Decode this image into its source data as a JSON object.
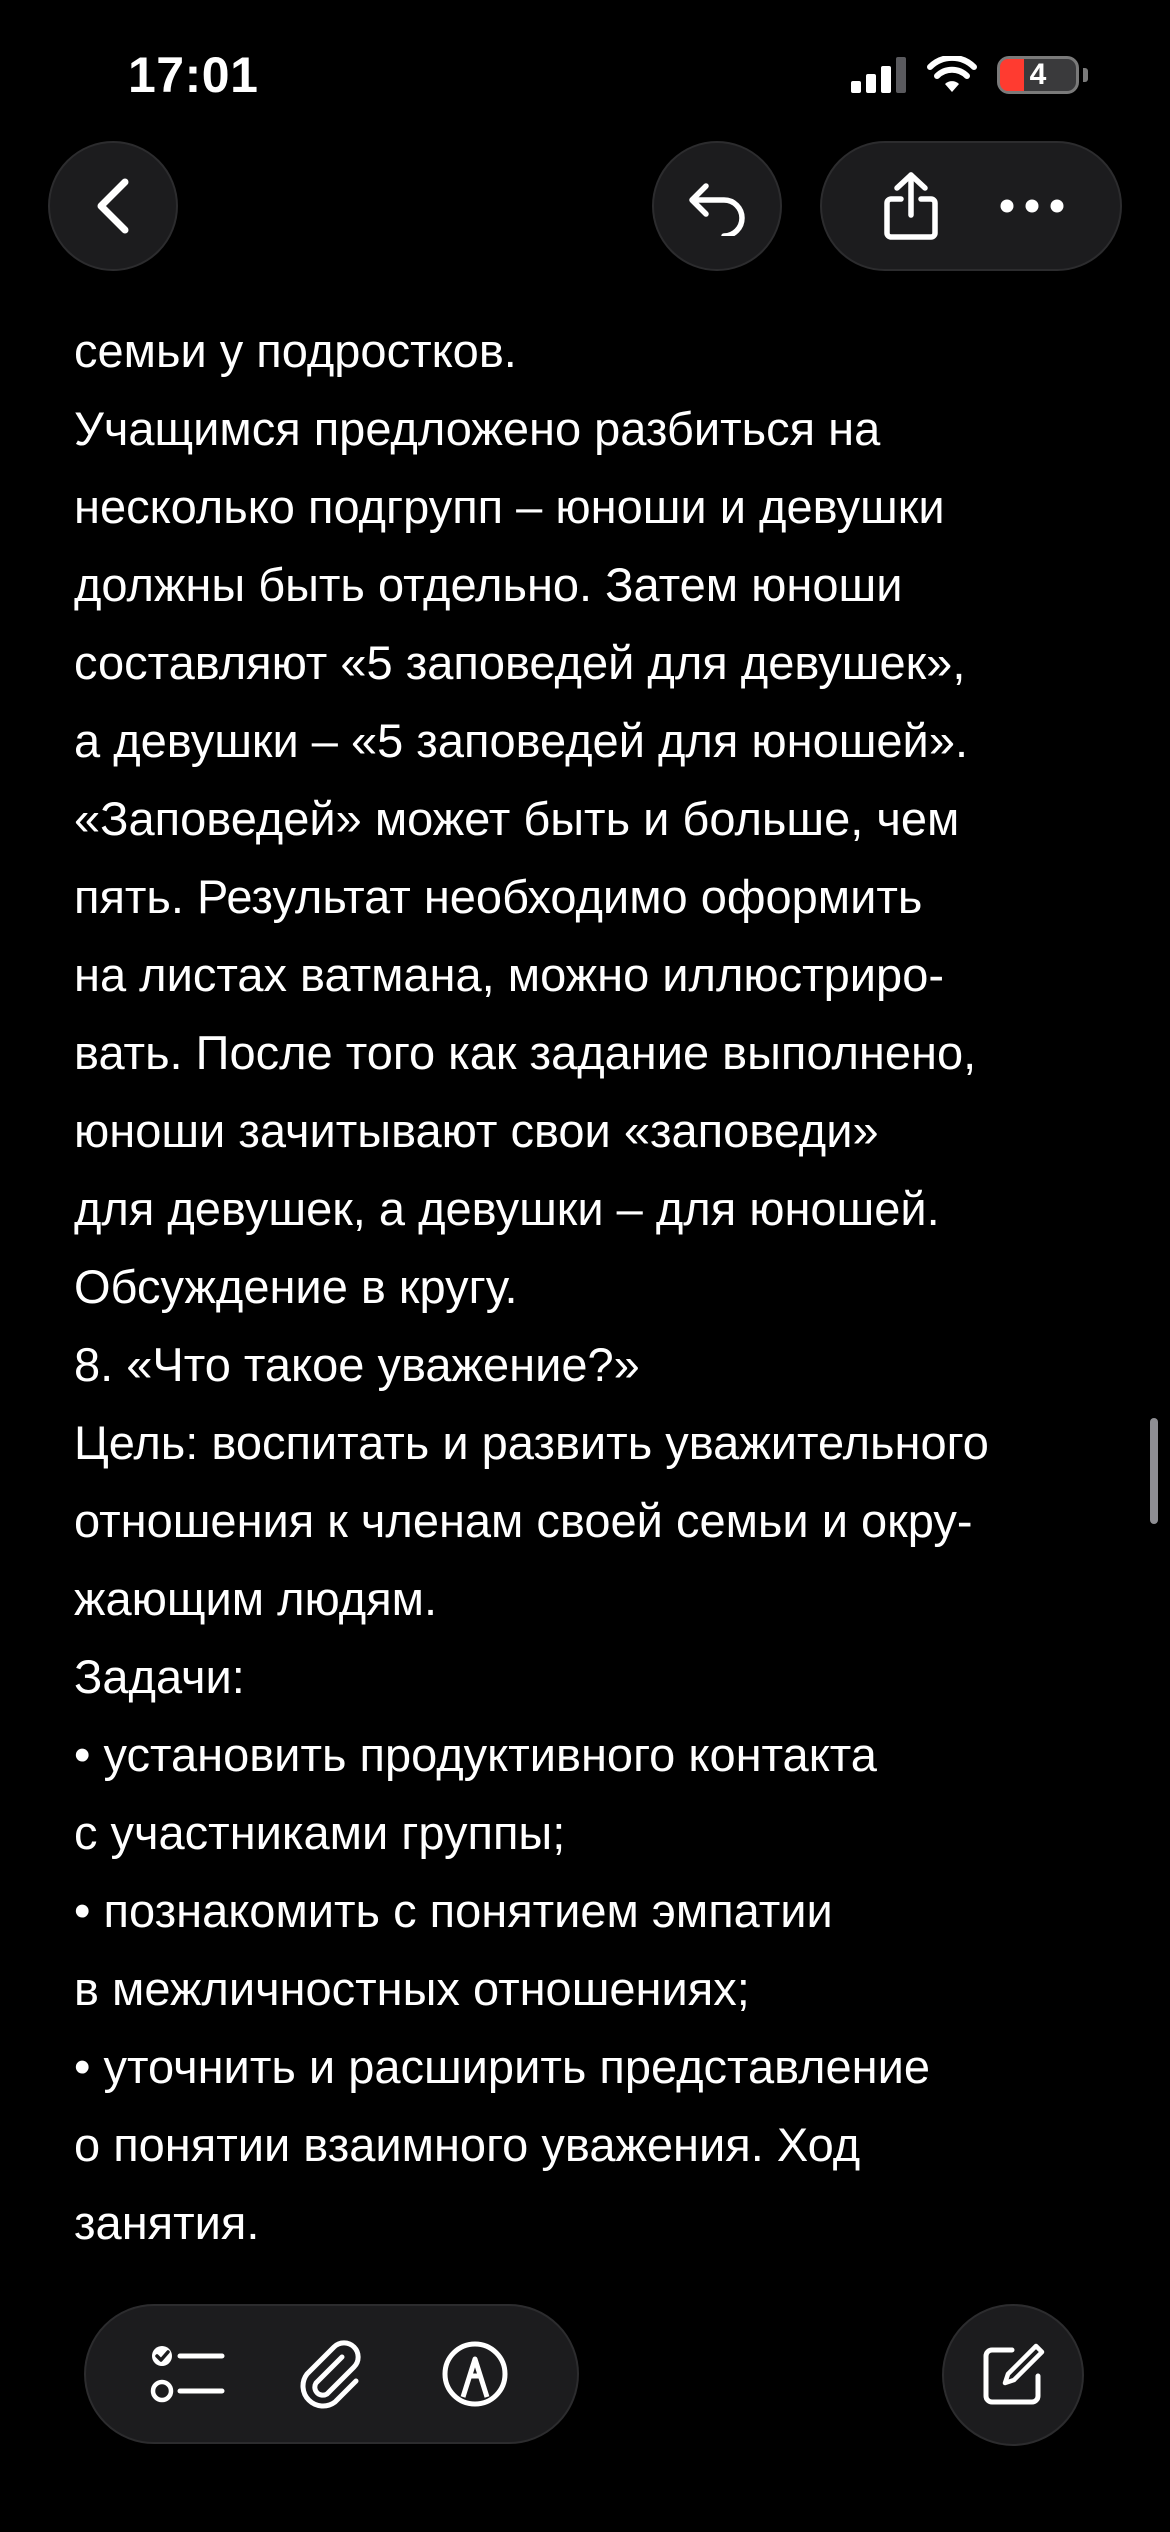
{
  "status_bar": {
    "time": "17:01",
    "battery_level": "4",
    "icons": [
      "cellular-signal-icon",
      "wifi-icon",
      "battery-icon"
    ]
  },
  "toolbar": {
    "icons": [
      "back-chevron-icon",
      "undo-icon",
      "share-icon",
      "more-icon"
    ]
  },
  "note": {
    "lines": [
      "семьи у подростков.",
      "Учащимся предложено разбиться на",
      "несколько подгрупп – юноши и девушки",
      "должны быть отдельно. Затем юноши",
      "составляют «5 заповедей для девушек»,",
      "а девушки – «5 заповедей для юношей».",
      "«Заповедей» может быть и больше, чем",
      "пять. Результат необходимо оформить",
      "на листах ватмана, можно иллюстриро-",
      "вать. После того как задание выполнено,",
      "юноши зачитывают свои «заповеди»",
      "для девушек, а девушки – для юношей.",
      "Обсуждение в кругу.",
      "8. «Что такое уважение?»",
      "Цель: воспитать и развить уважительного",
      "отношения к членам своей семьи и окру-",
      "жающим людям.",
      "Задачи:",
      "• установить продуктивного контакта",
      "с участниками группы;",
      "• познакомить с понятием эмпатии",
      "в межличностных отношениях;",
      "• уточнить и расширить представление",
      "о понятии взаимного уважения. Ход",
      "занятия."
    ]
  },
  "bottom_toolbar": {
    "icons": [
      "checklist-icon",
      "attachment-paperclip-icon",
      "markup-pen-icon",
      "compose-icon"
    ]
  },
  "colors": {
    "background": "#000000",
    "button_bg": "#1c1c1e",
    "text": "#ffffff",
    "battery_low": "#ff3b30"
  }
}
